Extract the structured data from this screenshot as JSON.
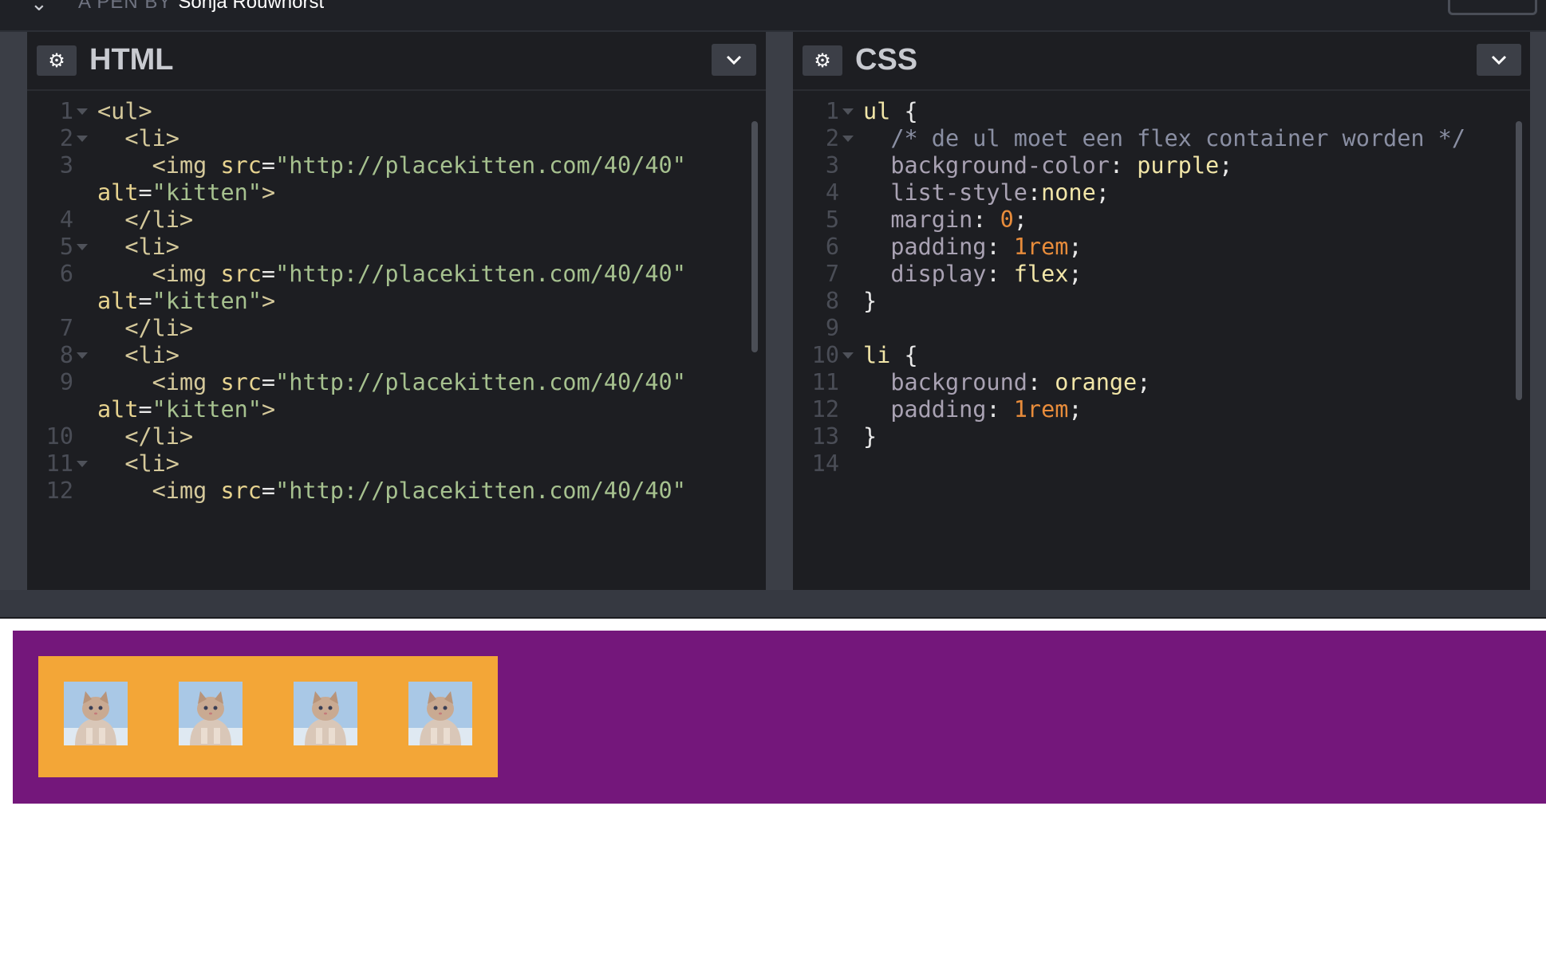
{
  "header": {
    "byline": "A PEN BY",
    "author": "Sonja Rouwhorst"
  },
  "html_pane": {
    "title": "HTML",
    "lines": [
      {
        "n": "1",
        "fold": true,
        "segs": [
          [
            "tag",
            "<ul>"
          ]
        ]
      },
      {
        "n": "2",
        "fold": true,
        "segs": [
          [
            "",
            "  "
          ],
          [
            "tag",
            "<li>"
          ]
        ]
      },
      {
        "n": "3",
        "fold": false,
        "segs": [
          [
            "",
            "    "
          ],
          [
            "tag",
            "<img "
          ],
          [
            "attr",
            "src"
          ],
          [
            "punct",
            "="
          ],
          [
            "str",
            "\"http://placekitten.com/40/40\""
          ]
        ]
      },
      {
        "n": "",
        "fold": false,
        "segs": [
          [
            "attr",
            "alt"
          ],
          [
            "punct",
            "="
          ],
          [
            "str",
            "\"kitten\""
          ],
          [
            "tag",
            ">"
          ]
        ]
      },
      {
        "n": "4",
        "fold": false,
        "segs": [
          [
            "",
            "  "
          ],
          [
            "tag",
            "</li>"
          ]
        ]
      },
      {
        "n": "5",
        "fold": true,
        "segs": [
          [
            "",
            "  "
          ],
          [
            "tag",
            "<li>"
          ]
        ]
      },
      {
        "n": "6",
        "fold": false,
        "segs": [
          [
            "",
            "    "
          ],
          [
            "tag",
            "<img "
          ],
          [
            "attr",
            "src"
          ],
          [
            "punct",
            "="
          ],
          [
            "str",
            "\"http://placekitten.com/40/40\""
          ]
        ]
      },
      {
        "n": "",
        "fold": false,
        "segs": [
          [
            "attr",
            "alt"
          ],
          [
            "punct",
            "="
          ],
          [
            "str",
            "\"kitten\""
          ],
          [
            "tag",
            ">"
          ]
        ]
      },
      {
        "n": "7",
        "fold": false,
        "segs": [
          [
            "",
            "  "
          ],
          [
            "tag",
            "</li>"
          ]
        ]
      },
      {
        "n": "8",
        "fold": true,
        "segs": [
          [
            "",
            "  "
          ],
          [
            "tag",
            "<li>"
          ]
        ]
      },
      {
        "n": "9",
        "fold": false,
        "segs": [
          [
            "",
            "    "
          ],
          [
            "tag",
            "<img "
          ],
          [
            "attr",
            "src"
          ],
          [
            "punct",
            "="
          ],
          [
            "str",
            "\"http://placekitten.com/40/40\""
          ]
        ]
      },
      {
        "n": "",
        "fold": false,
        "segs": [
          [
            "attr",
            "alt"
          ],
          [
            "punct",
            "="
          ],
          [
            "str",
            "\"kitten\""
          ],
          [
            "tag",
            ">"
          ]
        ]
      },
      {
        "n": "10",
        "fold": false,
        "segs": [
          [
            "",
            "  "
          ],
          [
            "tag",
            "</li>"
          ]
        ]
      },
      {
        "n": "11",
        "fold": true,
        "segs": [
          [
            "",
            "  "
          ],
          [
            "tag",
            "<li>"
          ]
        ]
      },
      {
        "n": "12",
        "fold": false,
        "segs": [
          [
            "",
            "    "
          ],
          [
            "tag",
            "<img "
          ],
          [
            "attr",
            "src"
          ],
          [
            "punct",
            "="
          ],
          [
            "str",
            "\"http://placekitten.com/40/40\""
          ]
        ]
      }
    ]
  },
  "css_pane": {
    "title": "CSS",
    "lines": [
      {
        "n": "1",
        "fold": true,
        "segs": [
          [
            "sel",
            "ul"
          ],
          [
            "punct",
            " {"
          ]
        ]
      },
      {
        "n": "2",
        "fold": true,
        "segs": [
          [
            "",
            "  "
          ],
          [
            "cmt",
            "/* de ul moet een flex container worden */"
          ]
        ]
      },
      {
        "n": "3",
        "fold": false,
        "segs": [
          [
            "",
            "  "
          ],
          [
            "prop",
            "background-color"
          ],
          [
            "punct",
            ": "
          ],
          [
            "val",
            "purple"
          ],
          [
            "punct",
            ";"
          ]
        ]
      },
      {
        "n": "4",
        "fold": false,
        "segs": [
          [
            "",
            "  "
          ],
          [
            "prop",
            "list-style"
          ],
          [
            "punct",
            ":"
          ],
          [
            "val",
            "none"
          ],
          [
            "punct",
            ";"
          ]
        ]
      },
      {
        "n": "5",
        "fold": false,
        "segs": [
          [
            "",
            "  "
          ],
          [
            "prop",
            "margin"
          ],
          [
            "punct",
            ": "
          ],
          [
            "num",
            "0"
          ],
          [
            "punct",
            ";"
          ]
        ]
      },
      {
        "n": "6",
        "fold": false,
        "segs": [
          [
            "",
            "  "
          ],
          [
            "prop",
            "padding"
          ],
          [
            "punct",
            ": "
          ],
          [
            "num",
            "1rem"
          ],
          [
            "punct",
            ";"
          ]
        ]
      },
      {
        "n": "7",
        "fold": false,
        "segs": [
          [
            "",
            "  "
          ],
          [
            "prop",
            "display"
          ],
          [
            "punct",
            ": "
          ],
          [
            "val",
            "flex"
          ],
          [
            "punct",
            ";"
          ]
        ]
      },
      {
        "n": "8",
        "fold": false,
        "segs": [
          [
            "punct",
            "}"
          ]
        ]
      },
      {
        "n": "9",
        "fold": false,
        "segs": []
      },
      {
        "n": "10",
        "fold": true,
        "segs": [
          [
            "sel",
            "li"
          ],
          [
            "punct",
            " {"
          ]
        ]
      },
      {
        "n": "11",
        "fold": false,
        "segs": [
          [
            "",
            "  "
          ],
          [
            "prop",
            "background"
          ],
          [
            "punct",
            ": "
          ],
          [
            "val",
            "orange"
          ],
          [
            "punct",
            ";"
          ]
        ]
      },
      {
        "n": "12",
        "fold": false,
        "segs": [
          [
            "",
            "  "
          ],
          [
            "prop",
            "padding"
          ],
          [
            "punct",
            ": "
          ],
          [
            "num",
            "1rem"
          ],
          [
            "punct",
            ";"
          ]
        ]
      },
      {
        "n": "13",
        "fold": false,
        "segs": [
          [
            "punct",
            "}"
          ]
        ]
      },
      {
        "n": "14",
        "fold": false,
        "segs": []
      }
    ]
  },
  "preview": {
    "kittens": [
      {
        "alt": "kitten"
      },
      {
        "alt": "kitten"
      },
      {
        "alt": "kitten"
      },
      {
        "alt": "kitten"
      }
    ],
    "colors": {
      "ul": "#74177b",
      "li": "#f3a637"
    }
  }
}
